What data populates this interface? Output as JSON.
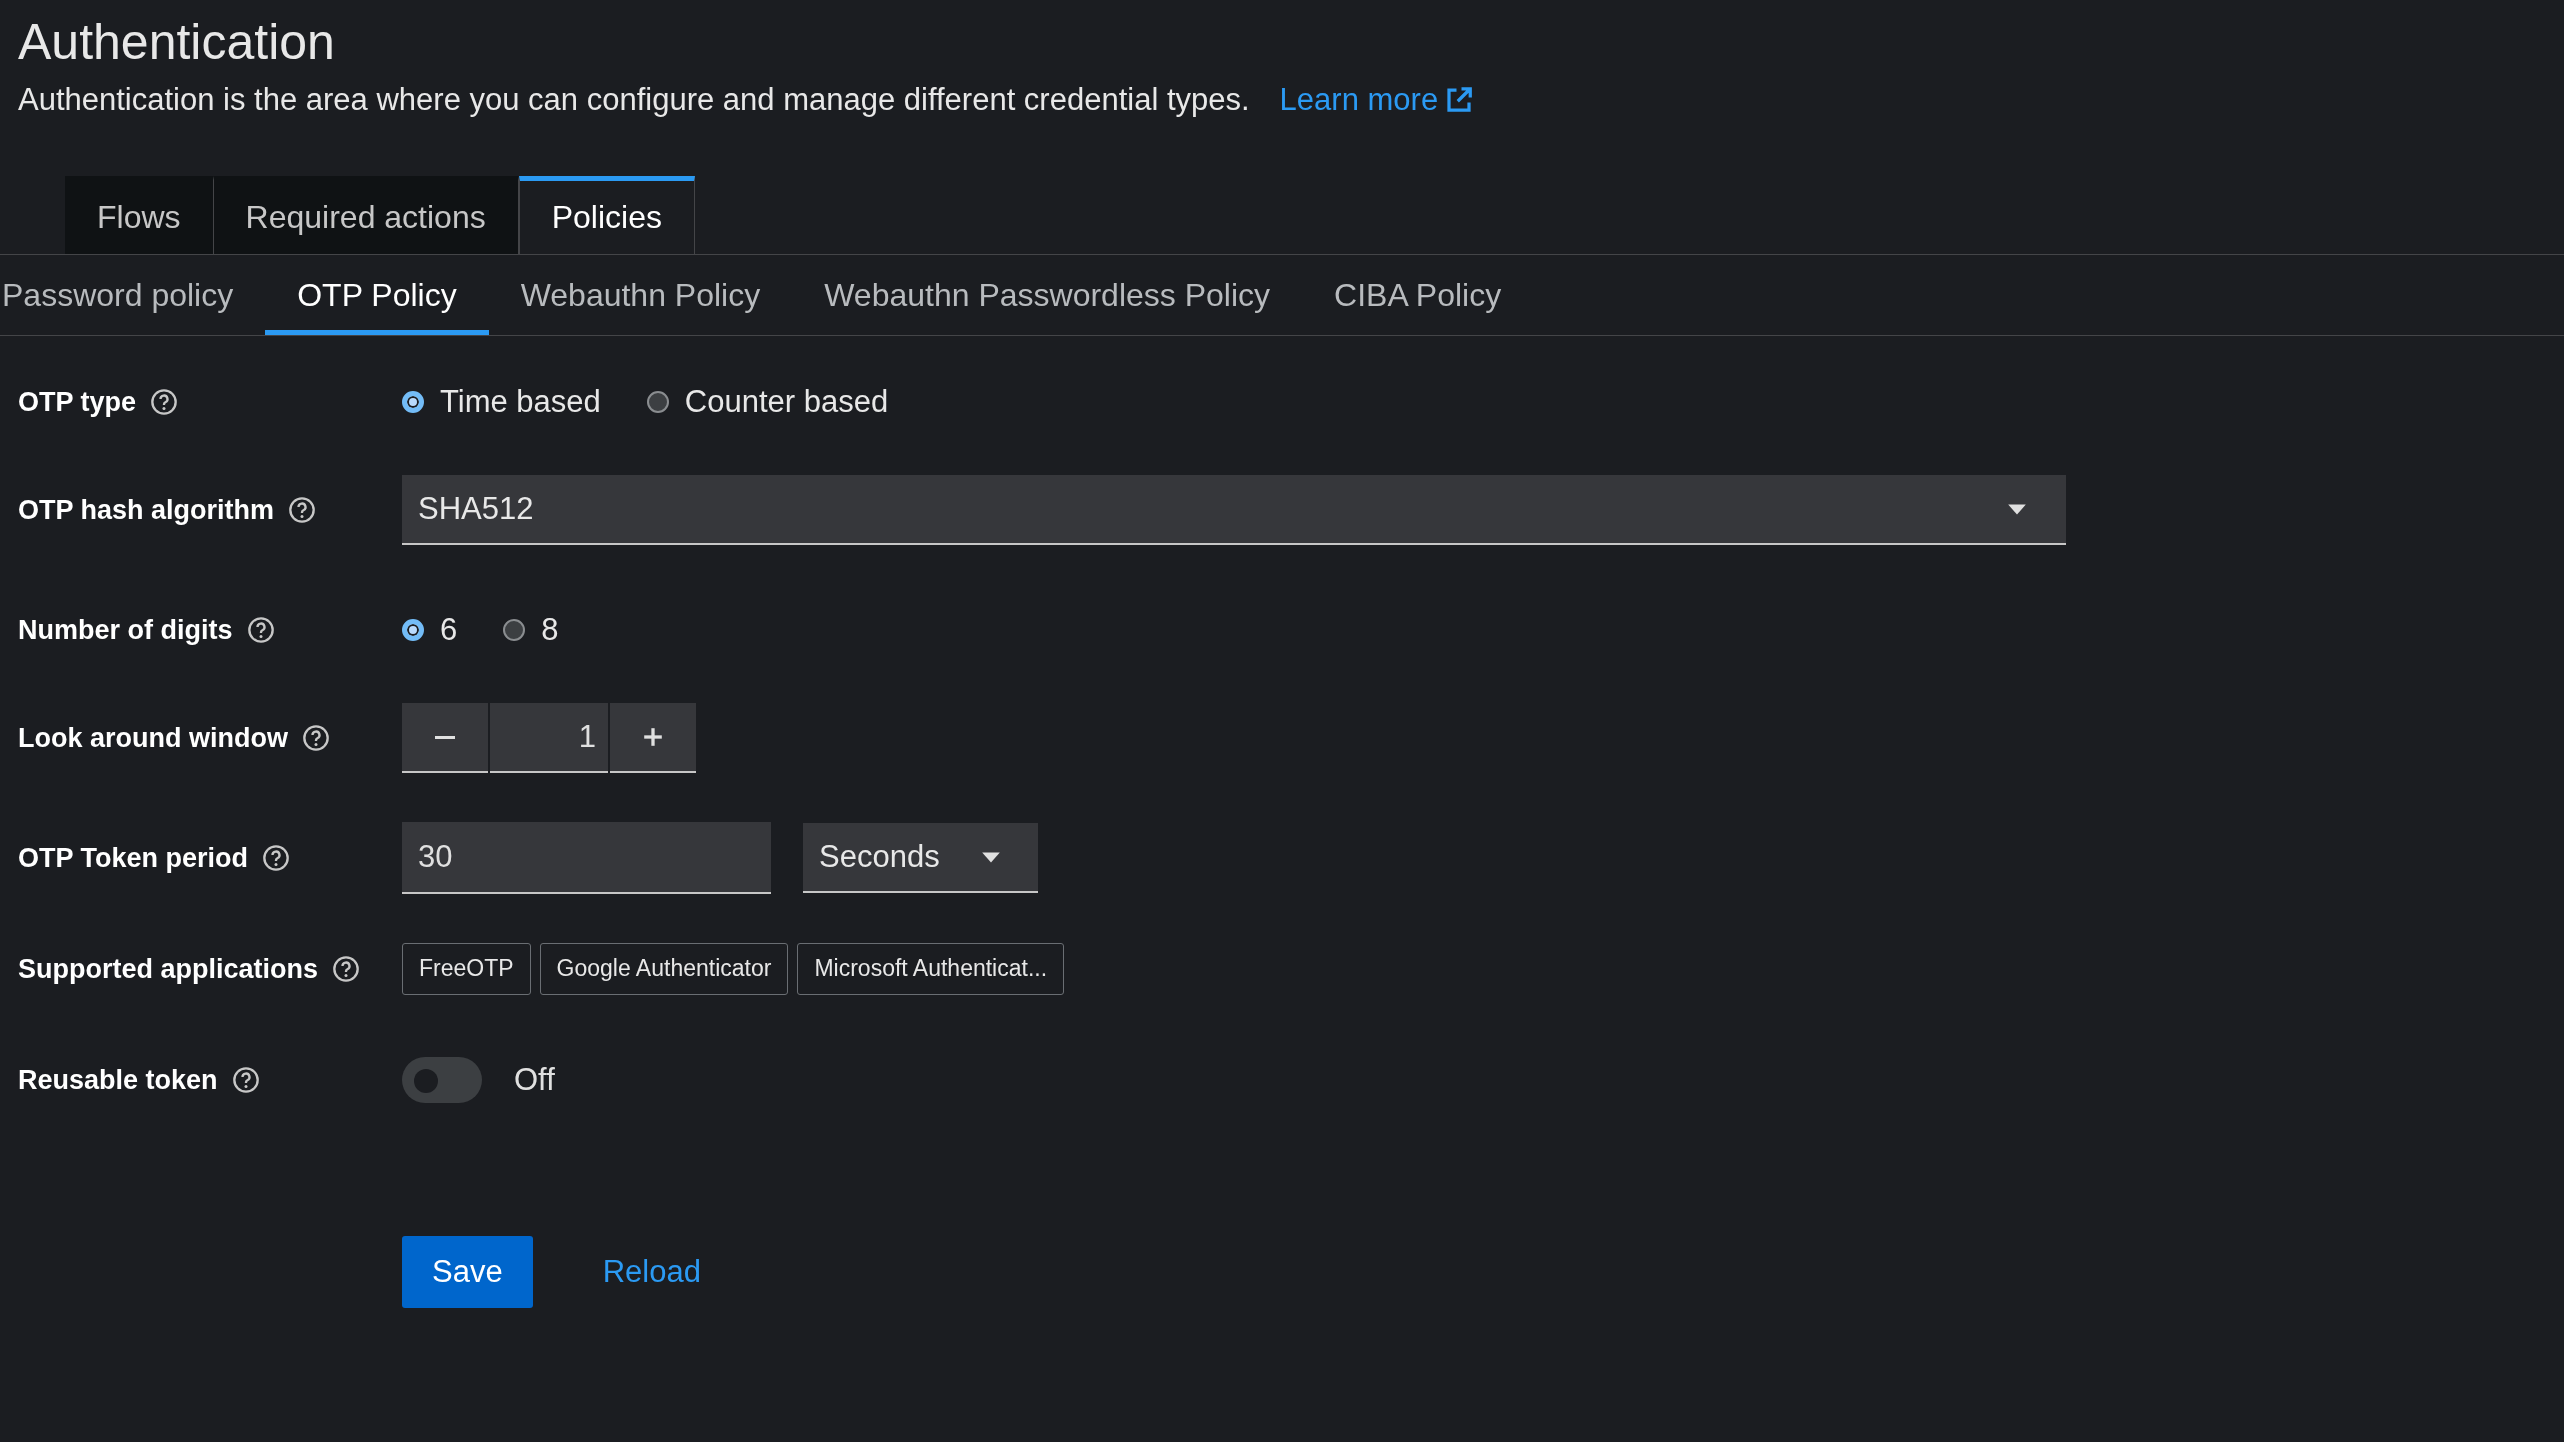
{
  "header": {
    "title": "Authentication",
    "description": "Authentication is the area where you can configure and manage different credential types.",
    "learn_more": "Learn more"
  },
  "tabs": [
    {
      "label": "Flows",
      "selected": false
    },
    {
      "label": "Required actions",
      "selected": false
    },
    {
      "label": "Policies",
      "selected": true
    }
  ],
  "subtabs": [
    {
      "label": "Password policy",
      "selected": false
    },
    {
      "label": "OTP Policy",
      "selected": true
    },
    {
      "label": "Webauthn Policy",
      "selected": false
    },
    {
      "label": "Webauthn Passwordless Policy",
      "selected": false
    },
    {
      "label": "CIBA Policy",
      "selected": false
    }
  ],
  "form": [
    {
      "kind": "radio",
      "label": "OTP type",
      "options": [
        {
          "label": "Time based",
          "selected": true
        },
        {
          "label": "Counter based",
          "selected": false
        }
      ]
    },
    {
      "kind": "select",
      "label": "OTP hash algorithm",
      "value": "SHA512"
    },
    {
      "kind": "radio",
      "label": "Number of digits",
      "options": [
        {
          "label": "6",
          "selected": true
        },
        {
          "label": "8",
          "selected": false
        }
      ]
    },
    {
      "kind": "number",
      "label": "Look around window",
      "value": "1"
    },
    {
      "kind": "period",
      "label": "OTP Token period",
      "value": "30",
      "unit": "Seconds"
    },
    {
      "kind": "chips",
      "label": "Supported applications",
      "chips": [
        "FreeOTP",
        "Google Authenticator",
        "Microsoft Authenticat..."
      ]
    },
    {
      "kind": "switch",
      "label": "Reusable token",
      "on": false,
      "state_label": "Off"
    }
  ],
  "actions": [
    {
      "kind": "primary",
      "label": "Save"
    },
    {
      "kind": "link",
      "label": "Reload"
    }
  ]
}
